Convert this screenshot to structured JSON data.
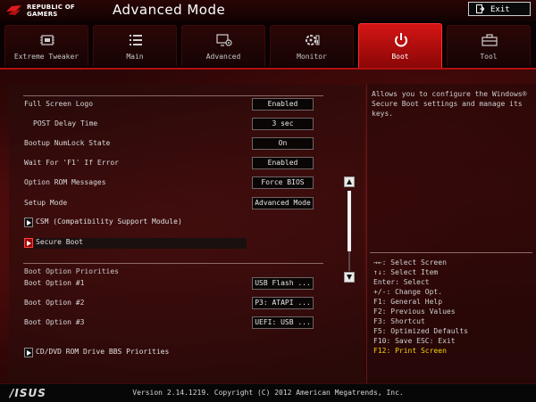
{
  "header": {
    "logo_line1": "REPUBLIC OF",
    "logo_line2": "GAMERS",
    "mode_title": "Advanced Mode",
    "exit_label": "Exit"
  },
  "tabs": [
    {
      "label": "Extreme Tweaker",
      "icon": "tweaker-icon",
      "active": false
    },
    {
      "label": "Main",
      "icon": "list-icon",
      "active": false
    },
    {
      "label": "Advanced",
      "icon": "advanced-icon",
      "active": false
    },
    {
      "label": "Monitor",
      "icon": "monitor-icon",
      "active": false
    },
    {
      "label": "Boot",
      "icon": "power-icon",
      "active": true
    },
    {
      "label": "Tool",
      "icon": "tool-icon",
      "active": false
    }
  ],
  "settings": [
    {
      "label": "Full Screen Logo",
      "value": "Enabled"
    },
    {
      "label": "POST Delay Time",
      "value": "3 sec"
    },
    {
      "label": "Bootup NumLock State",
      "value": "On"
    },
    {
      "label": "Wait For 'F1' If Error",
      "value": "Enabled"
    },
    {
      "label": "Option ROM Messages",
      "value": "Force BIOS"
    },
    {
      "label": "Setup Mode",
      "value": "Advanced Mode"
    }
  ],
  "submenus": {
    "csm": "CSM (Compatibility Support Module)",
    "secure_boot": "Secure Boot",
    "cd_dvd": "CD/DVD ROM Drive BBS Priorities"
  },
  "boot_priorities": {
    "title": "Boot Option Priorities",
    "options": [
      {
        "label": "Boot Option #1",
        "value": "USB Flash ..."
      },
      {
        "label": "Boot Option #2",
        "value": "P3: ATAPI ..."
      },
      {
        "label": "Boot Option #3",
        "value": "UEFI: USB ..."
      }
    ]
  },
  "help": {
    "description": "Allows you to configure the Windows® Secure Boot settings and manage its keys.",
    "keys": [
      "→←: Select Screen",
      "↑↓: Select Item",
      "Enter: Select",
      "+/-: Change Opt.",
      "F1: General Help",
      "F2: Previous Values",
      "F3: Shortcut",
      "F5: Optimized Defaults",
      "F10: Save  ESC: Exit",
      "F12: Print Screen"
    ]
  },
  "footer": {
    "brand": "/ISUS",
    "version": "Version 2.14.1219. Copyright (C) 2012 American Megatrends, Inc."
  },
  "colors": {
    "accent_red": "#d61515",
    "print_screen_yellow": "#f5d300"
  }
}
